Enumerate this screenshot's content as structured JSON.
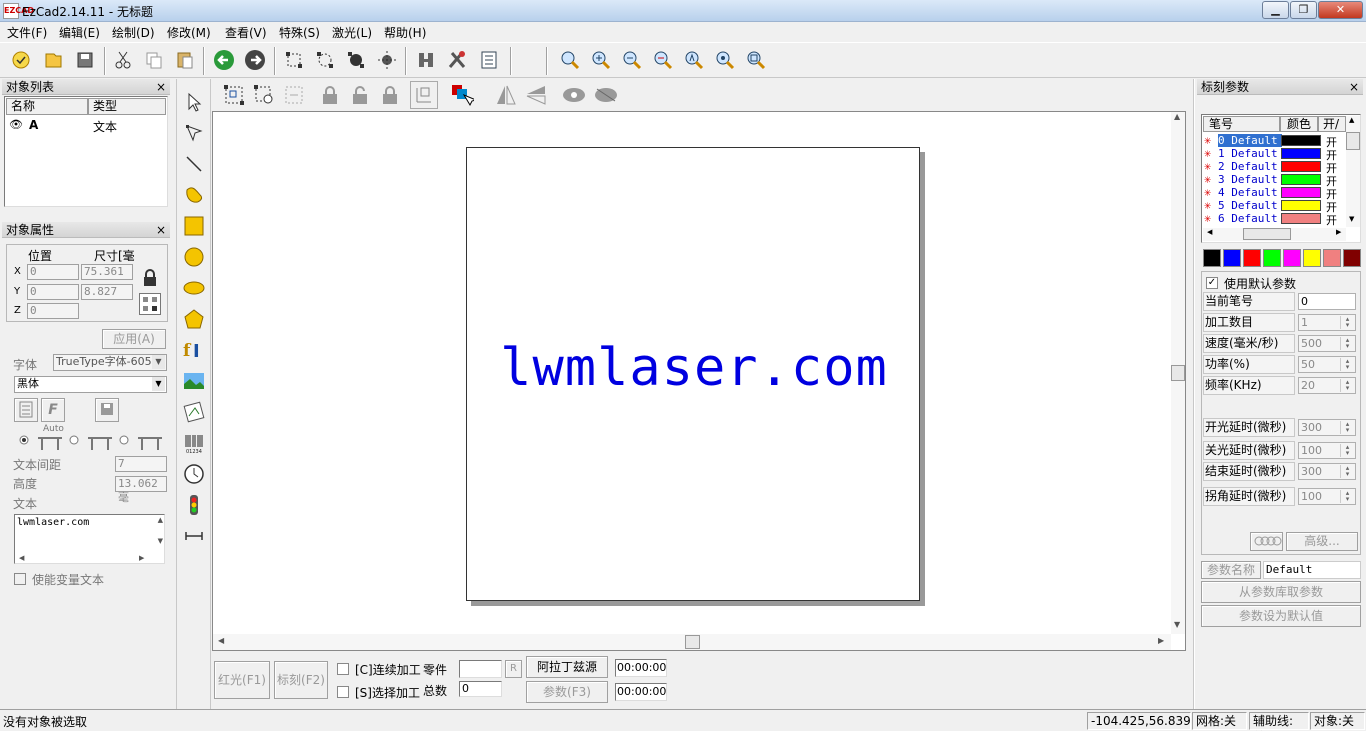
{
  "window": {
    "title": "EzCad2.14.11 - 无标题",
    "app_icon": "EZCAD",
    "controls": {
      "minimize": "▁",
      "restore": "❐",
      "close": "✕"
    }
  },
  "menu": [
    "文件(F)",
    "编辑(E)",
    "绘制(D)",
    "修改(M)",
    "查看(V)",
    "特殊(S)",
    "激光(L)",
    "帮助(H)"
  ],
  "toolbar": {
    "icons": [
      "new-icon",
      "open-icon",
      "save-icon",
      "cut-icon",
      "copy-icon",
      "paste-icon",
      "undo-icon",
      "redo-icon",
      "node-edit-icon",
      "select-node-icon",
      "align-node-icon",
      "snap-node-icon",
      "bitmap-icon",
      "settings-icon",
      "params-icon",
      "zoom-icon",
      "zoom-in-icon",
      "zoom-out-icon",
      "zoom-fit-icon",
      "zoom-window-icon",
      "zoom-all-icon",
      "zoom-select-icon"
    ]
  },
  "object_list": {
    "title": "对象列表",
    "close": "×",
    "col_name": "名称",
    "col_type": "类型",
    "rows": [
      {
        "name": "A",
        "type": "文本"
      }
    ]
  },
  "object_props": {
    "title": "对象属性",
    "close": "×",
    "pos_label": "位置",
    "size_label": "尺寸[毫",
    "x_label": "X",
    "y_label": "Y",
    "z_label": "Z",
    "x_pos": "0",
    "x_size": "75.361",
    "y_pos": "0",
    "y_size": "8.827",
    "z_pos": "0",
    "apply": "应用(A)",
    "font_label": "字体",
    "font_type": "TrueType字体-605",
    "font_name": "黑体",
    "auto_label": "Auto",
    "spacing_label": "文本间距",
    "spacing_value": "7",
    "height_label": "高度",
    "height_value": "13.062毫",
    "text_label": "文本",
    "text_value": "lwmlaser.com",
    "variable_label": "使能变量文本",
    "italic_glyph": "F"
  },
  "canvas": {
    "text": "lwmlaser.com",
    "text_color": "#0000e0"
  },
  "bottom": {
    "red_light": "红光(F1)",
    "mark": "标刻(F2)",
    "continuous": "[C]连续加工",
    "part_label": "零件",
    "part_value": "",
    "reset": "R",
    "select_proc": "[S]选择加工",
    "total_label": "总数",
    "total_value": "0",
    "font_btn": "阿拉丁兹源",
    "param_btn": "参数(F3)",
    "time1": "00:00:00",
    "time2": "00:00:00"
  },
  "mark_params": {
    "title": "标刻参数",
    "close": "×",
    "col_pen": "笔号",
    "col_color": "颜色",
    "col_on": "开/",
    "pens": [
      {
        "name": "0 Default",
        "color": "#000000",
        "on": "开"
      },
      {
        "name": "1 Default",
        "color": "#0000ff",
        "on": "开"
      },
      {
        "name": "2 Default",
        "color": "#ff0000",
        "on": "开"
      },
      {
        "name": "3 Default",
        "color": "#00ff00",
        "on": "开"
      },
      {
        "name": "4 Default",
        "color": "#ff00ff",
        "on": "开"
      },
      {
        "name": "5 Default",
        "color": "#ffff00",
        "on": "开"
      },
      {
        "name": "6 Default",
        "color": "#f08080",
        "on": "开"
      }
    ],
    "swatches": [
      "#000000",
      "#0000ff",
      "#ff0000",
      "#00ff00",
      "#ff00ff",
      "#ffff00",
      "#f08080",
      "#800000"
    ],
    "use_default": "使用默认参数",
    "params": [
      {
        "label": "当前笔号",
        "value": "0"
      },
      {
        "label": "加工数目",
        "value": "1"
      },
      {
        "label": "速度(毫米/秒)",
        "value": "500"
      },
      {
        "label": "功率(%)",
        "value": "50"
      },
      {
        "label": "频率(KHz)",
        "value": "20"
      },
      {
        "label": "开光延时(微秒)",
        "value": "300"
      },
      {
        "label": "关光延时(微秒)",
        "value": "100"
      },
      {
        "label": "结束延时(微秒)",
        "value": "300"
      },
      {
        "label": "拐角延时(微秒)",
        "value": "100"
      }
    ],
    "advanced": "高级...",
    "param_name_label": "参数名称",
    "param_name_value": "Default",
    "load_from_lib": "从参数库取参数",
    "set_default": "参数设为默认值"
  },
  "status": {
    "message": "没有对象被选取",
    "coords": "-104.425,56.839",
    "grid": "网格:关",
    "guide": "辅助线:关",
    "obj": "对象:关"
  }
}
